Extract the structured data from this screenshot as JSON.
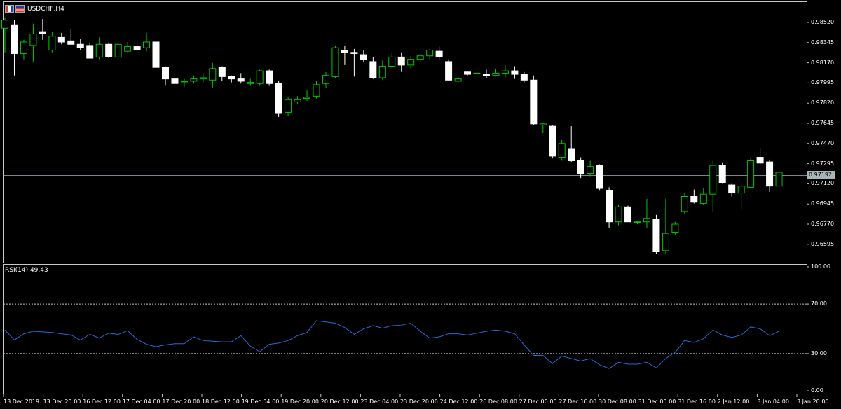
{
  "window": {
    "symbol_title": "USDCHF,H4",
    "icons": [
      "chart-window-icon",
      "flag-icon"
    ]
  },
  "colors": {
    "background": "#000000",
    "bull_candle": "#000000",
    "bear_candle": "#ffffff",
    "wick_bull": "#00c800",
    "wick_bear": "#ffffff",
    "rsi_line": "#1e6ed8",
    "level_line": "#c0c0c0",
    "current_price_line": "#6f8c8c"
  },
  "indicator": {
    "label": "RSI(14) 49.43"
  },
  "current_price": {
    "value": 0.97192,
    "label": "0.97192"
  },
  "price_axis": {
    "labels": [
      "0.98520",
      "0.98345",
      "0.98170",
      "0.97995",
      "0.97820",
      "0.97645",
      "0.97470",
      "0.97295",
      "0.97120",
      "0.96945",
      "0.96770",
      "0.96595"
    ]
  },
  "rsi_axis": {
    "labels": [
      "100.00",
      "70.00",
      "30.00",
      "0.00"
    ]
  },
  "time_axis": {
    "labels": [
      "13 Dec 2019",
      "13 Dec 20:00",
      "16 Dec 12:00",
      "17 Dec 04:00",
      "17 Dec 20:00",
      "18 Dec 12:00",
      "19 Dec 04:00",
      "19 Dec 20:00",
      "20 Dec 12:00",
      "23 Dec 04:00",
      "23 Dec 20:00",
      "24 Dec 12:00",
      "26 Dec 08:00",
      "27 Dec 00:00",
      "27 Dec 16:00",
      "30 Dec 08:00",
      "31 Dec 00:00",
      "31 Dec 16:00",
      "2 Jan 12:00",
      "3 Jan 04:00",
      "3 Jan 20:00"
    ]
  },
  "chart_data": [
    {
      "type": "candlestick",
      "title": "USDCHF,H4",
      "ylim": [
        0.9652,
        0.9862
      ],
      "candles": [
        {
          "o": 0.9847,
          "h": 0.9856,
          "l": 0.9826,
          "c": 0.9854
        },
        {
          "o": 0.985,
          "h": 0.9854,
          "l": 0.9806,
          "c": 0.9825
        },
        {
          "o": 0.9825,
          "h": 0.9837,
          "l": 0.982,
          "c": 0.9835
        },
        {
          "o": 0.9832,
          "h": 0.9851,
          "l": 0.9818,
          "c": 0.9842
        },
        {
          "o": 0.9844,
          "h": 0.9855,
          "l": 0.9837,
          "c": 0.9842
        },
        {
          "o": 0.9828,
          "h": 0.9844,
          "l": 0.9826,
          "c": 0.984
        },
        {
          "o": 0.9839,
          "h": 0.9843,
          "l": 0.9833,
          "c": 0.9835
        },
        {
          "o": 0.9836,
          "h": 0.9846,
          "l": 0.9833,
          "c": 0.9833
        },
        {
          "o": 0.9833,
          "h": 0.9838,
          "l": 0.9828,
          "c": 0.983
        },
        {
          "o": 0.9832,
          "h": 0.9834,
          "l": 0.9821,
          "c": 0.9821
        },
        {
          "o": 0.9822,
          "h": 0.9839,
          "l": 0.982,
          "c": 0.9833
        },
        {
          "o": 0.9833,
          "h": 0.9834,
          "l": 0.9821,
          "c": 0.9822
        },
        {
          "o": 0.9822,
          "h": 0.9834,
          "l": 0.982,
          "c": 0.9833
        },
        {
          "o": 0.9827,
          "h": 0.9835,
          "l": 0.9826,
          "c": 0.9831
        },
        {
          "o": 0.9831,
          "h": 0.9835,
          "l": 0.9827,
          "c": 0.9828
        },
        {
          "o": 0.983,
          "h": 0.9843,
          "l": 0.9827,
          "c": 0.9835
        },
        {
          "o": 0.9835,
          "h": 0.9837,
          "l": 0.9811,
          "c": 0.9813
        },
        {
          "o": 0.9813,
          "h": 0.9814,
          "l": 0.9797,
          "c": 0.9803
        },
        {
          "o": 0.9803,
          "h": 0.9809,
          "l": 0.9797,
          "c": 0.9799
        },
        {
          "o": 0.9801,
          "h": 0.9803,
          "l": 0.9796,
          "c": 0.9801
        },
        {
          "o": 0.9801,
          "h": 0.9806,
          "l": 0.9799,
          "c": 0.9803
        },
        {
          "o": 0.9803,
          "h": 0.9808,
          "l": 0.98,
          "c": 0.9804
        },
        {
          "o": 0.9802,
          "h": 0.9817,
          "l": 0.9795,
          "c": 0.9812
        },
        {
          "o": 0.9813,
          "h": 0.9814,
          "l": 0.9801,
          "c": 0.9805
        },
        {
          "o": 0.9805,
          "h": 0.9806,
          "l": 0.98,
          "c": 0.9803
        },
        {
          "o": 0.9803,
          "h": 0.9808,
          "l": 0.9799,
          "c": 0.9801
        },
        {
          "o": 0.9799,
          "h": 0.9803,
          "l": 0.9797,
          "c": 0.98
        },
        {
          "o": 0.9799,
          "h": 0.9811,
          "l": 0.9797,
          "c": 0.981
        },
        {
          "o": 0.981,
          "h": 0.9811,
          "l": 0.9797,
          "c": 0.9799
        },
        {
          "o": 0.9799,
          "h": 0.9801,
          "l": 0.977,
          "c": 0.9773
        },
        {
          "o": 0.9774,
          "h": 0.9787,
          "l": 0.9771,
          "c": 0.9785
        },
        {
          "o": 0.9783,
          "h": 0.9788,
          "l": 0.9781,
          "c": 0.9785
        },
        {
          "o": 0.9786,
          "h": 0.9793,
          "l": 0.9784,
          "c": 0.9787
        },
        {
          "o": 0.9788,
          "h": 0.9801,
          "l": 0.9786,
          "c": 0.9798
        },
        {
          "o": 0.9799,
          "h": 0.9809,
          "l": 0.9795,
          "c": 0.9806
        },
        {
          "o": 0.9805,
          "h": 0.9832,
          "l": 0.9804,
          "c": 0.983
        },
        {
          "o": 0.9828,
          "h": 0.9832,
          "l": 0.9815,
          "c": 0.9826
        },
        {
          "o": 0.9826,
          "h": 0.9829,
          "l": 0.9805,
          "c": 0.9825
        },
        {
          "o": 0.9824,
          "h": 0.9828,
          "l": 0.9818,
          "c": 0.982
        },
        {
          "o": 0.9818,
          "h": 0.9822,
          "l": 0.9803,
          "c": 0.9804
        },
        {
          "o": 0.9804,
          "h": 0.9819,
          "l": 0.9802,
          "c": 0.9814
        },
        {
          "o": 0.9814,
          "h": 0.9826,
          "l": 0.9812,
          "c": 0.9822
        },
        {
          "o": 0.9822,
          "h": 0.9826,
          "l": 0.9809,
          "c": 0.9815
        },
        {
          "o": 0.9815,
          "h": 0.9823,
          "l": 0.9812,
          "c": 0.982
        },
        {
          "o": 0.982,
          "h": 0.9825,
          "l": 0.9818,
          "c": 0.9823
        },
        {
          "o": 0.9823,
          "h": 0.9829,
          "l": 0.982,
          "c": 0.9828
        },
        {
          "o": 0.9827,
          "h": 0.9831,
          "l": 0.9819,
          "c": 0.9822
        },
        {
          "o": 0.9818,
          "h": 0.982,
          "l": 0.9801,
          "c": 0.9802
        },
        {
          "o": 0.9801,
          "h": 0.9805,
          "l": 0.9799,
          "c": 0.9803
        },
        {
          "o": 0.9809,
          "h": 0.981,
          "l": 0.9806,
          "c": 0.9807
        },
        {
          "o": 0.9808,
          "h": 0.9812,
          "l": 0.9804,
          "c": 0.9808
        },
        {
          "o": 0.9807,
          "h": 0.9811,
          "l": 0.9804,
          "c": 0.9806
        },
        {
          "o": 0.9806,
          "h": 0.9812,
          "l": 0.9805,
          "c": 0.9808
        },
        {
          "o": 0.9808,
          "h": 0.9815,
          "l": 0.9804,
          "c": 0.981
        },
        {
          "o": 0.981,
          "h": 0.9814,
          "l": 0.9803,
          "c": 0.9807
        },
        {
          "o": 0.9807,
          "h": 0.9809,
          "l": 0.98,
          "c": 0.9802
        },
        {
          "o": 0.9802,
          "h": 0.9806,
          "l": 0.9763,
          "c": 0.9764
        },
        {
          "o": 0.9763,
          "h": 0.9765,
          "l": 0.9756,
          "c": 0.9764
        },
        {
          "o": 0.9762,
          "h": 0.9763,
          "l": 0.9734,
          "c": 0.9736
        },
        {
          "o": 0.9735,
          "h": 0.975,
          "l": 0.9732,
          "c": 0.9747
        },
        {
          "o": 0.9742,
          "h": 0.9762,
          "l": 0.9731,
          "c": 0.9732
        },
        {
          "o": 0.9732,
          "h": 0.9735,
          "l": 0.9717,
          "c": 0.9721
        },
        {
          "o": 0.9721,
          "h": 0.9732,
          "l": 0.9718,
          "c": 0.9727
        },
        {
          "o": 0.9728,
          "h": 0.9729,
          "l": 0.9706,
          "c": 0.9708
        },
        {
          "o": 0.9706,
          "h": 0.9709,
          "l": 0.9674,
          "c": 0.9679
        },
        {
          "o": 0.9679,
          "h": 0.9694,
          "l": 0.9676,
          "c": 0.9692
        },
        {
          "o": 0.9692,
          "h": 0.9693,
          "l": 0.9679,
          "c": 0.9679
        },
        {
          "o": 0.9679,
          "h": 0.968,
          "l": 0.9677,
          "c": 0.9679
        },
        {
          "o": 0.9679,
          "h": 0.9699,
          "l": 0.9674,
          "c": 0.9682
        },
        {
          "o": 0.9681,
          "h": 0.9685,
          "l": 0.9651,
          "c": 0.9653
        },
        {
          "o": 0.9654,
          "h": 0.9699,
          "l": 0.9651,
          "c": 0.9669
        },
        {
          "o": 0.967,
          "h": 0.9679,
          "l": 0.9668,
          "c": 0.9677
        },
        {
          "o": 0.9688,
          "h": 0.9704,
          "l": 0.9686,
          "c": 0.9701
        },
        {
          "o": 0.9701,
          "h": 0.9707,
          "l": 0.9695,
          "c": 0.9696
        },
        {
          "o": 0.9695,
          "h": 0.9708,
          "l": 0.9694,
          "c": 0.9703
        },
        {
          "o": 0.9703,
          "h": 0.9732,
          "l": 0.9688,
          "c": 0.9728
        },
        {
          "o": 0.9728,
          "h": 0.973,
          "l": 0.9712,
          "c": 0.9713
        },
        {
          "o": 0.9711,
          "h": 0.9712,
          "l": 0.9701,
          "c": 0.9704
        },
        {
          "o": 0.9704,
          "h": 0.9711,
          "l": 0.969,
          "c": 0.971
        },
        {
          "o": 0.9709,
          "h": 0.9735,
          "l": 0.9708,
          "c": 0.9732
        },
        {
          "o": 0.9735,
          "h": 0.9743,
          "l": 0.9729,
          "c": 0.973
        },
        {
          "o": 0.9731,
          "h": 0.9733,
          "l": 0.9705,
          "c": 0.971
        },
        {
          "o": 0.971,
          "h": 0.9724,
          "l": 0.9709,
          "c": 0.9722
        }
      ]
    },
    {
      "type": "line",
      "title": "RSI(14) 49.43",
      "ylim": [
        0,
        100
      ],
      "levels": [
        70,
        30
      ],
      "values": [
        49,
        41,
        46,
        48,
        47.5,
        47,
        46,
        45,
        41,
        45.5,
        42.5,
        46.5,
        45.5,
        48.5,
        41.5,
        37.5,
        35.5,
        37,
        38,
        38,
        43.5,
        40.5,
        40,
        39.5,
        39.5,
        44.5,
        36,
        31.5,
        37.5,
        38.5,
        40.5,
        44.5,
        47,
        56.5,
        55.5,
        54.5,
        51,
        45.5,
        50,
        52.5,
        50.5,
        52.5,
        53,
        54.5,
        48,
        42.5,
        43.5,
        46,
        46,
        45,
        46.5,
        48,
        49,
        48,
        46,
        37,
        28.5,
        28.5,
        22,
        28,
        26,
        24,
        26,
        21,
        18,
        23,
        21.5,
        21.5,
        23,
        18.5,
        26,
        31,
        40.5,
        39,
        42,
        49,
        45,
        43,
        45,
        51.5,
        50,
        44.5,
        48
      ]
    }
  ]
}
